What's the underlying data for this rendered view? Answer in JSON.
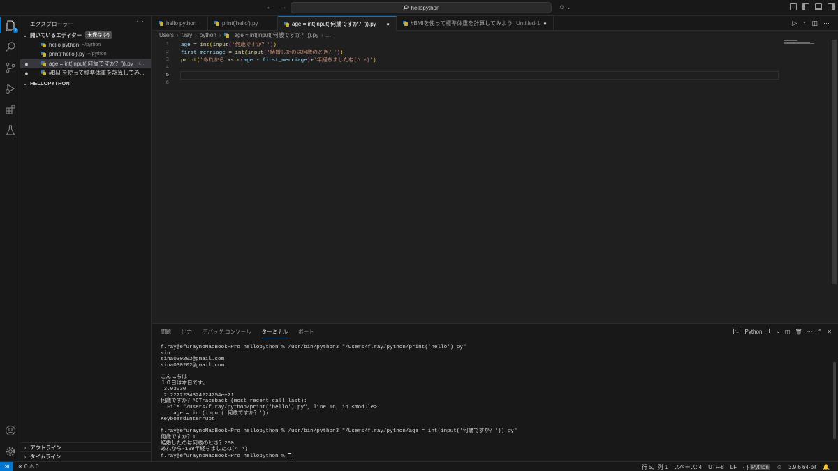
{
  "titlebar": {
    "search_text": "hellopython"
  },
  "activity_bar": {
    "explorer_badge": "2"
  },
  "sidebar": {
    "title": "エクスプローラー",
    "more": "···",
    "open_editors_header": "開いているエディター",
    "unsaved_badge": "未保存 (2)",
    "open_editors": [
      {
        "name": "hello python",
        "path": "~/python",
        "dirty": false,
        "selected": false
      },
      {
        "name": "print('hello').py",
        "path": "~/python",
        "dirty": false,
        "selected": false
      },
      {
        "name": "age = int(input('何歳ですか？')).py",
        "path": "~/...",
        "dirty": true,
        "selected": true
      },
      {
        "name": "#BMIを使って標準体重を計算してみ...",
        "path": "",
        "dirty": true,
        "selected": false
      }
    ],
    "folder_header": "HELLOPYTHON",
    "outline_label": "アウトライン",
    "timeline_label": "タイムライン"
  },
  "tabs": [
    {
      "label": "hello python",
      "desc": "",
      "dirty": false,
      "active": false
    },
    {
      "label": "print('hello').py",
      "desc": "",
      "dirty": false,
      "active": false
    },
    {
      "label": "age = int(input('何歳ですか？')).py",
      "desc": "",
      "dirty": true,
      "active": true
    },
    {
      "label": "#BMIを使って標準体重を計算してみよう",
      "desc": "Untitled-1",
      "dirty": true,
      "active": false
    }
  ],
  "breadcrumb": [
    "Users",
    "f.ray",
    "python",
    "age = int(input('何歳ですか？')).py",
    "..."
  ],
  "editor": {
    "line_numbers": [
      "1",
      "2",
      "3",
      "4",
      "5",
      "6"
    ],
    "current_line": "5"
  },
  "panel": {
    "tabs": [
      "問題",
      "出力",
      "デバッグ コンソール",
      "ターミナル",
      "ポート"
    ],
    "active_tab": "ターミナル",
    "terminal_profile": "Python",
    "terminal_lines": [
      "f.ray@efuraynoMacBook-Pro hellopython % /usr/bin/python3 \"/Users/f.ray/python/print('hello').py\"",
      "sin",
      "sina030202@gmail.com",
      "sina030202@gmail.com",
      "",
      "こんにちは",
      "１０日は本日です。",
      " 3.03030",
      " 2.2222234324224254e+21",
      "何歳ですか？^CTraceback (most recent call last):",
      "  File \"/Users/f.ray/python/print('hello').py\", line 16, in <module>",
      "    age = int(input('何歳ですか？'))",
      "KeyboardInterrupt",
      "",
      "f.ray@efuraynoMacBook-Pro hellopython % /usr/bin/python3 \"/Users/f.ray/python/age = int(input('何歳ですか？')).py\"",
      "何歳ですか？1",
      "結婚したのは何歳のとき？200",
      "あれから-199年経ちましたね(^ ^)",
      "f.ray@efuraynoMacBook-Pro hellopython % "
    ]
  },
  "statusbar": {
    "errors": "0",
    "warnings": "0",
    "position": "行 5、列 1",
    "spaces": "スペース: 4",
    "encoding": "UTF-8",
    "eol": "LF",
    "language_braces": "{ }",
    "language": "Python",
    "interpreter": "3.9.6 64-bit"
  },
  "colors": {
    "accent": "#0078d4",
    "editor_bg": "#1f1f1f",
    "chrome_bg": "#181818"
  }
}
